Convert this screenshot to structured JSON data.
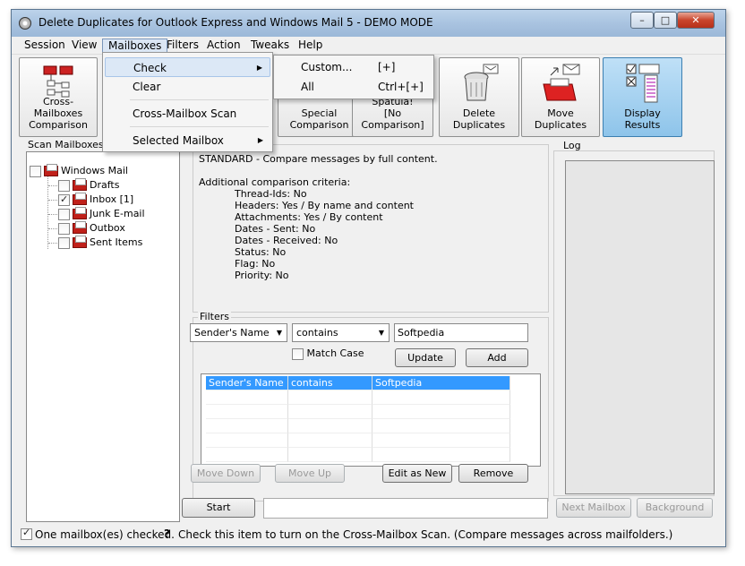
{
  "window": {
    "title": "Delete Duplicates for Outlook Express and Windows Mail 5 - DEMO MODE"
  },
  "menubar": {
    "items": [
      "Session",
      "View",
      "Mailboxes",
      "Filters",
      "Action",
      "Tweaks",
      "Help"
    ],
    "active": "Mailboxes"
  },
  "mailboxes_menu": {
    "items": [
      {
        "label": "Check",
        "has_submenu": true
      },
      {
        "label": "Clear",
        "has_submenu": false
      },
      {
        "label": "Cross-Mailbox Scan",
        "has_submenu": false
      },
      {
        "label": "Selected Mailbox",
        "has_submenu": true
      }
    ]
  },
  "check_submenu": {
    "items": [
      {
        "label": "Custom...",
        "shortcut": "[+]"
      },
      {
        "label": "All",
        "shortcut": "Ctrl+[+]"
      }
    ]
  },
  "toolbar": {
    "cross_mailboxes": "Cross-Mailboxes Comparison",
    "cross_mailboxes_l1": "Cross-Mailboxes",
    "cross_mailboxes_l2": "Comparison",
    "special_l1": "Special",
    "special_l2": "Comparison",
    "spatula_l1": "Spatula!",
    "spatula_l2": "[No Comparison]",
    "delete_l1": "Delete",
    "delete_l2": "Duplicates",
    "move_l1": "Move",
    "move_l2": "Duplicates",
    "display_l1": "Display",
    "display_l2": "Results"
  },
  "scan": {
    "label": "Scan Mailboxes",
    "tree": [
      {
        "label": "Windows Mail",
        "checked": false
      },
      {
        "label": "Drafts",
        "checked": false
      },
      {
        "label": "Inbox [1]",
        "checked": true
      },
      {
        "label": "Junk E-mail",
        "checked": false
      },
      {
        "label": "Outbox",
        "checked": false
      },
      {
        "label": "Sent Items",
        "checked": false
      }
    ]
  },
  "info": {
    "mode": "STANDARD - Compare messages by full content.",
    "criteria_title": "Additional comparison criteria:",
    "criteria": [
      "Thread-Ids: No",
      "Headers: Yes / By name and content",
      "Attachments: Yes / By content",
      "Dates - Sent: No",
      "Dates - Received: No",
      "Status: No",
      "Flag: No",
      "Priority: No"
    ]
  },
  "filters": {
    "label": "Filters",
    "field": "Sender's Name",
    "operator": "contains",
    "value": "Softpedia",
    "match_case": "Match Case",
    "update": "Update",
    "add": "Add",
    "rows": [
      [
        "Sender's Name",
        "contains",
        "Softpedia"
      ]
    ],
    "move_down": "Move Down",
    "move_up": "Move Up",
    "edit_as_new": "Edit as New",
    "remove": "Remove"
  },
  "log": {
    "label": "Log"
  },
  "bottom": {
    "start": "Start",
    "next_mailbox": "Next Mailbox",
    "background": "Background"
  },
  "status": {
    "checked": "One mailbox(es) checked.",
    "hint": "Check this item to turn on the Cross-Mailbox Scan. (Compare messages across mailfolders.)"
  }
}
